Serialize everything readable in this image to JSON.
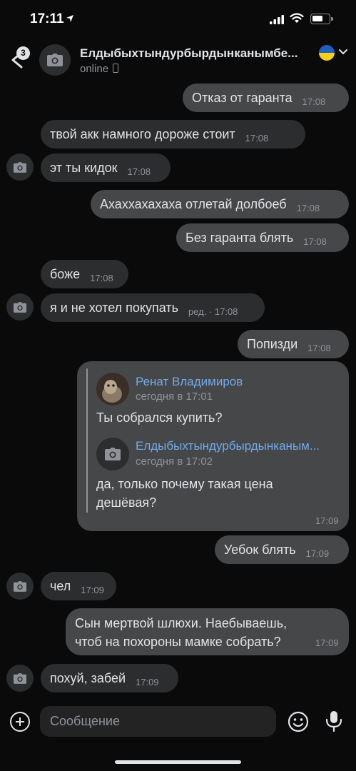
{
  "status_bar": {
    "time": "17:11"
  },
  "header": {
    "unread_count": "3",
    "contact_name": "Елдыбыхтындурбырдынканымбе...",
    "presence": "online"
  },
  "messages": [
    {
      "text": "Отказ от гаранта",
      "time": "17:08"
    },
    {
      "text": "твой акк намного дороже стоит",
      "time": "17:08"
    },
    {
      "text": "эт ты кидок",
      "time": "17:08"
    },
    {
      "text": "Ахаххахахаха отлетай долбоеб",
      "time": "17:08"
    },
    {
      "text": "Без гаранта блять",
      "time": "17:08"
    },
    {
      "text": "боже",
      "time": "17:08"
    },
    {
      "text": "я и не хотел покупать",
      "time": "ред. · 17:08"
    },
    {
      "text": "Попизди",
      "time": "17:08"
    },
    {
      "text": "Уебок блять",
      "time": "17:09"
    },
    {
      "text": "чел",
      "time": "17:09"
    },
    {
      "text": "похуй, забей",
      "time": "17:09"
    }
  ],
  "multiline_message": {
    "line1": "Сын мертвой шлюхи. Наебываешь,",
    "line2": "чтоб на похороны мамке собрать?",
    "time": "17:09"
  },
  "forwarded": {
    "time": "17:09",
    "outer": {
      "author": "Ренат Владимиров",
      "date": "сегодня в 17:01",
      "text": "Ты собрался купить?"
    },
    "inner": {
      "author": "Елдыбыхтындурбырдынканым...",
      "date": "сегодня в 17:02",
      "line1": "да, только почему такая цена",
      "line2": "дешёвая?"
    }
  },
  "composer": {
    "placeholder": "Сообщение"
  },
  "icons": [
    "location-arrow-icon",
    "signal-icon",
    "wifi-icon",
    "battery-icon",
    "back-icon",
    "camera-icon",
    "phone-icon",
    "ukraine-flag-icon",
    "chevron-down-icon",
    "plus-icon",
    "smile-icon",
    "mic-icon"
  ]
}
